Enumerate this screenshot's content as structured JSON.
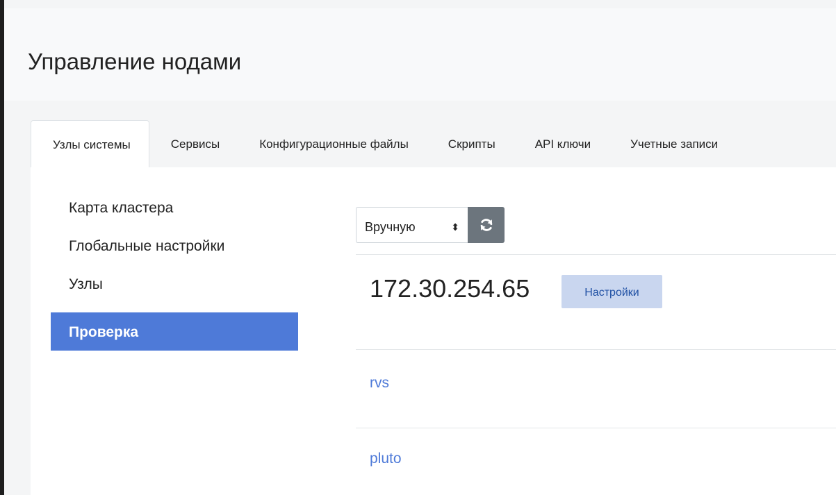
{
  "page": {
    "title": "Управление нодами"
  },
  "tabs": [
    {
      "label": "Узлы системы",
      "active": true
    },
    {
      "label": "Сервисы",
      "active": false
    },
    {
      "label": "Конфигурационные файлы",
      "active": false
    },
    {
      "label": "Скрипты",
      "active": false
    },
    {
      "label": "API ключи",
      "active": false
    },
    {
      "label": "Учетные записи",
      "active": false
    }
  ],
  "sidebar": {
    "items": [
      {
        "label": "Карта кластера",
        "active": false
      },
      {
        "label": "Глобальные настройки",
        "active": false
      },
      {
        "label": "Узлы",
        "active": false
      },
      {
        "label": "Проверка",
        "active": true
      }
    ]
  },
  "toolbar": {
    "refresh_mode_value": "Вручную",
    "refresh_icon": "refresh-icon"
  },
  "node": {
    "ip": "172.30.254.65",
    "settings_label": "Настройки"
  },
  "services": [
    {
      "name": "rvs"
    },
    {
      "name": "pluto"
    }
  ],
  "colors": {
    "accent": "#4e7ad8",
    "button_secondary": "#6c757d",
    "settings_button_bg": "#c9d6ef"
  }
}
